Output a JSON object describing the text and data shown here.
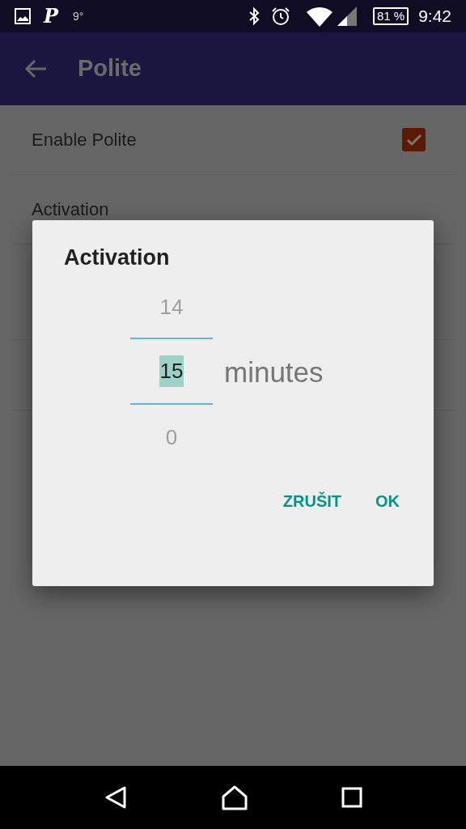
{
  "status_bar": {
    "app_letter": "P",
    "temperature": "9°",
    "battery": "81 %",
    "time": "9:42"
  },
  "app_bar": {
    "title": "Polite"
  },
  "settings": [
    {
      "kind": "checkbox",
      "label": "Enable Polite",
      "checked": true
    },
    {
      "kind": "plain",
      "label": "Activation"
    }
  ],
  "dialog": {
    "title": "Activation",
    "picker": {
      "previous": "14",
      "value": "15",
      "next": "0",
      "unit": "minutes"
    },
    "buttons": [
      "ZRUŠIT",
      "OK"
    ]
  }
}
